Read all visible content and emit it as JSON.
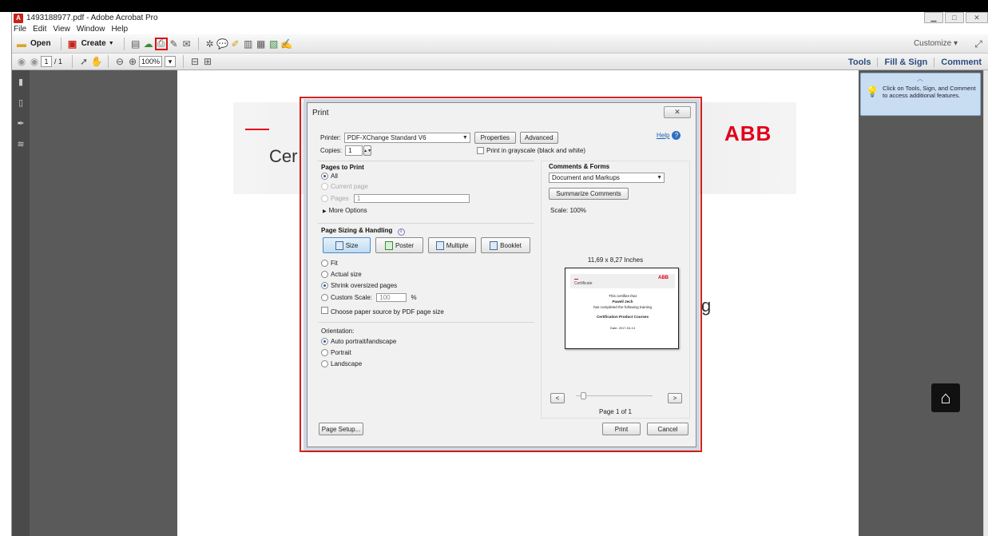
{
  "window": {
    "title": "1493188977.pdf - Adobe Acrobat Pro",
    "app_icon_label": "A",
    "controls": [
      "▁",
      "□",
      "✕"
    ]
  },
  "menu": [
    "File",
    "Edit",
    "View",
    "Window",
    "Help"
  ],
  "toolbar": {
    "open_label": "Open",
    "create_label": "Create",
    "customize_label": "Customize"
  },
  "nav": {
    "page_current": "1",
    "page_total": "/ 1",
    "zoom": "100%"
  },
  "panes": [
    "Tools",
    "Fill & Sign",
    "Comment"
  ],
  "tip": "Click on Tools, Sign, and Comment to access additional features.",
  "document": {
    "heading_fragment": "Cer",
    "heading_tail": "g",
    "logo": "ABB"
  },
  "dialog": {
    "title": "Print",
    "close": "✕",
    "printer_label": "Printer:",
    "printer_value": "PDF-XChange Standard V6",
    "properties_label": "Properties",
    "advanced_label": "Advanced",
    "help_label": "Help",
    "copies_label": "Copies:",
    "copies_value": "1",
    "grayscale_label": "Print in grayscale (black and white)",
    "pages_to_print": {
      "title": "Pages to Print",
      "all": "All",
      "current_page": "Current page",
      "pages": "Pages",
      "pages_value": "1",
      "more_options": "More Options"
    },
    "sizing": {
      "title": "Page Sizing & Handling",
      "buttons": [
        "Size",
        "Poster",
        "Multiple",
        "Booklet"
      ],
      "fit": "Fit",
      "actual_size": "Actual size",
      "shrink": "Shrink oversized pages",
      "custom_scale": "Custom Scale:",
      "custom_scale_value": "100",
      "percent": "%",
      "paper_source": "Choose paper source by PDF page size"
    },
    "orientation": {
      "title": "Orientation:",
      "auto": "Auto portrait/landscape",
      "portrait": "Portrait",
      "landscape": "Landscape"
    },
    "comments_forms": {
      "title": "Comments & Forms",
      "value": "Document and Markups",
      "summarize": "Summarize Comments",
      "scale": "Scale: 100%"
    },
    "preview": {
      "dimensions": "11,69 x 8,27 Inches",
      "cert_title": "Certificate",
      "logo": "ABB",
      "line1": "This certifies that",
      "line2": "Pawell Jech",
      "line3": "has completed the following training",
      "line4": "Certification Product Courses",
      "line5": "Date: 2017-04-14",
      "prev": "<",
      "next": ">",
      "page_indicator": "Page 1 of 1"
    },
    "page_setup_label": "Page Setup...",
    "print_label": "Print",
    "cancel_label": "Cancel"
  }
}
